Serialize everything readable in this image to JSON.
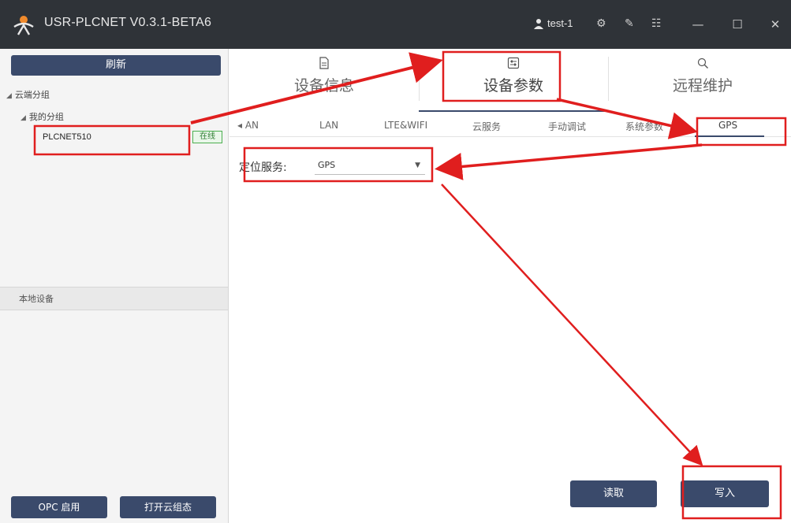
{
  "app": {
    "title": "USR-PLCNET V0.3.1-BETA6",
    "user": "test-1"
  },
  "sidebar": {
    "refresh_label": "刷新",
    "cloud_group": "云端分组",
    "my_group": "我的分组",
    "device_name": "PLCNET510",
    "device_status": "在线",
    "local_devices": "本地设备",
    "opc_button": "OPC 启用",
    "open_cloud_button": "打开云组态"
  },
  "main": {
    "tabs": [
      {
        "label": "设备信息",
        "icon": "document-icon"
      },
      {
        "label": "设备参数",
        "icon": "sliders-icon"
      },
      {
        "label": "远程维护",
        "icon": "search-doc-icon"
      }
    ],
    "subtabs": [
      "◂ AN",
      "LAN",
      "LTE&WIFI",
      "云服务",
      "手动调试",
      "系统参数",
      "GPS"
    ],
    "active_subtab": "GPS",
    "location_label": "定位服务:",
    "location_value": "GPS",
    "read_button": "读取",
    "write_button": "写入"
  },
  "colors": {
    "titlebar": "#2f3338",
    "primary_button": "#3a4a6b",
    "annotation": "#e01e1e",
    "online": "#2e7d32"
  }
}
